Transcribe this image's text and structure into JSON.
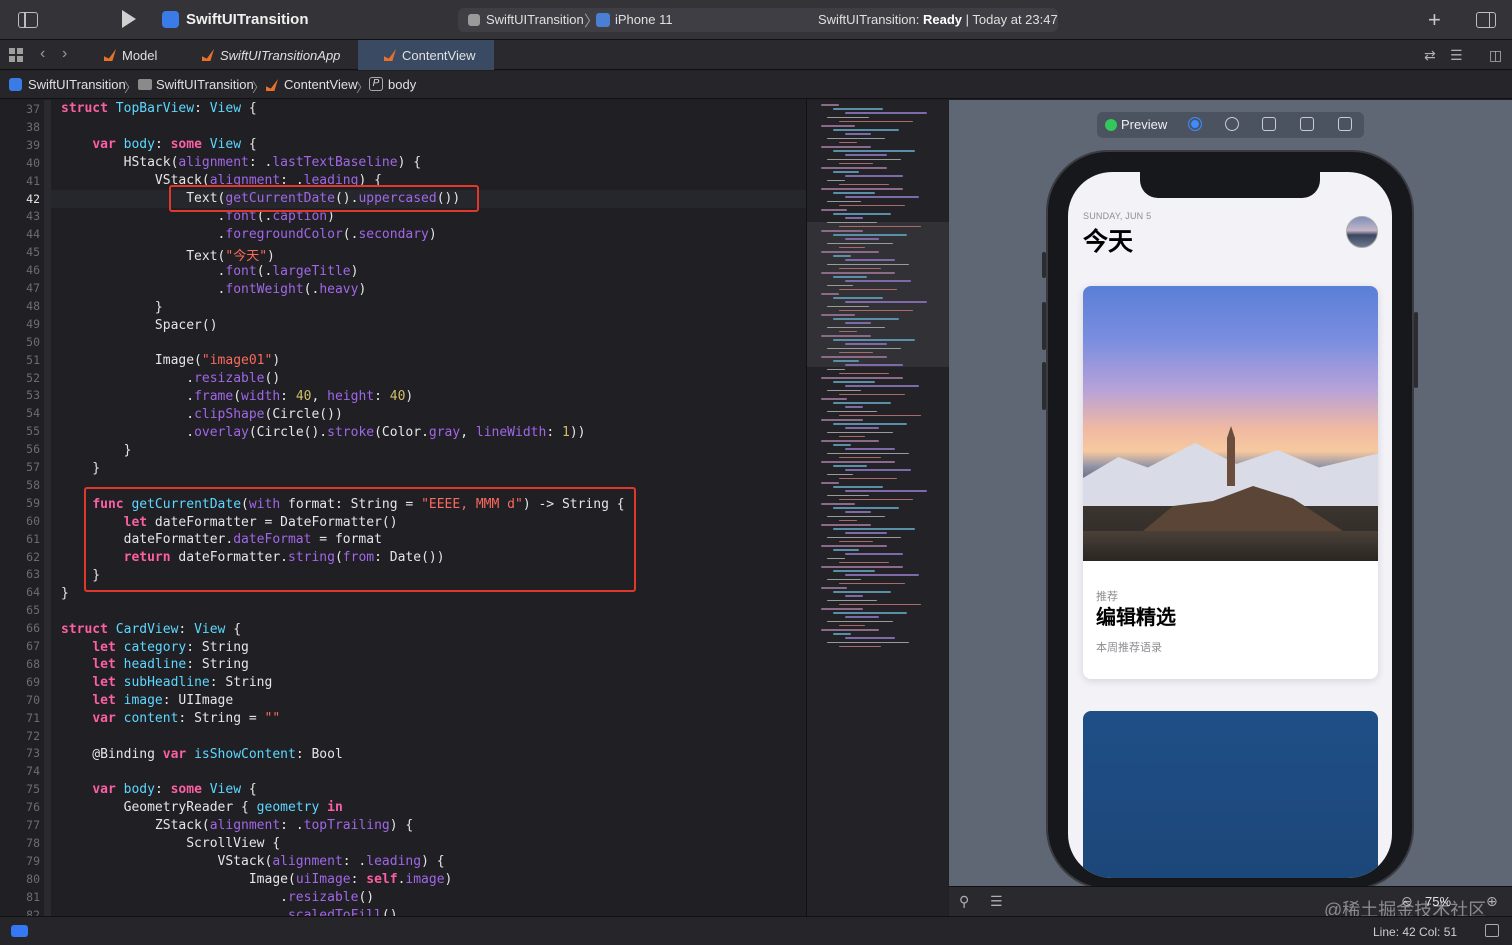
{
  "titlebar": {
    "app_title": "SwiftUITransition",
    "scheme": "SwiftUITransition",
    "device": "iPhone 11",
    "status_project": "SwiftUITransition:",
    "status_state": "Ready",
    "status_time": "| Today at 23:47"
  },
  "tabs": [
    {
      "label": "Model"
    },
    {
      "label": "SwiftUITransitionApp"
    },
    {
      "label": "ContentView"
    }
  ],
  "breadcrumb": {
    "project": "SwiftUITransition",
    "folder": "SwiftUITransition",
    "file": "ContentView",
    "symbol": "body"
  },
  "editor": {
    "current_line": 42,
    "line_numbers": [
      "37",
      "38",
      "39",
      "40",
      "41",
      "42",
      "43",
      "44",
      "45",
      "46",
      "47",
      "48",
      "49",
      "50",
      "51",
      "52",
      "53",
      "54",
      "55",
      "56",
      "57",
      "58",
      "59",
      "60",
      "61",
      "62",
      "63",
      "64",
      "65",
      "66",
      "67",
      "68",
      "69",
      "70",
      "71",
      "72",
      "73",
      "74",
      "75",
      "76",
      "77",
      "78",
      "79",
      "80",
      "81",
      "82"
    ]
  },
  "preview": {
    "label": "Preview",
    "app": {
      "date": "SUNDAY, JUN 5",
      "title": "今天",
      "card": {
        "category": "推荐",
        "headline": "编辑精选",
        "sub_headline": "本周推荐语录"
      }
    },
    "zoom": "75%",
    "watermark": "@稀土掘金技术社区"
  },
  "statusbar": {
    "position": "Line: 42  Col: 51"
  },
  "colors": {
    "keyword": "#fc5fa3",
    "type": "#5dd8ff",
    "function": "#a167e6",
    "string": "#fc6a5d",
    "number": "#d0bf69",
    "highlight_box": "#e0392b",
    "accent": "#3478f6"
  }
}
